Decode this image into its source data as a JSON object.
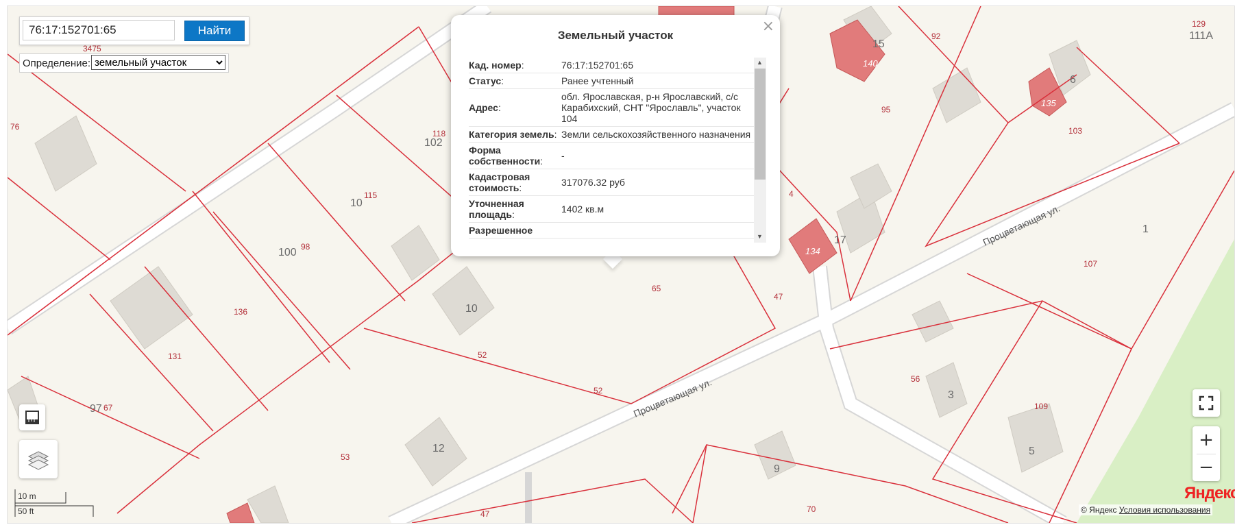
{
  "search": {
    "value": "76:17:152701:65",
    "button_label": "Найти"
  },
  "definition": {
    "label": "Определение:",
    "selected": "земельный участок"
  },
  "popup": {
    "title": "Земельный участок",
    "close": "×",
    "rows": [
      {
        "key": "Кад. номер",
        "value": "76:17:152701:65"
      },
      {
        "key": "Статус",
        "value": "Ранее учтенный"
      },
      {
        "key": "Адрес",
        "value": "обл. Ярославская, р-н Ярославский, с/с Карабихский, СНТ \"Ярославль\", участок 104"
      },
      {
        "key": "Категория земель",
        "value": "Земли сельскохозяйственного назначения"
      },
      {
        "key": "Форма собственности",
        "value": "-"
      },
      {
        "key": "Кадастровая стоимость",
        "value": "317076.32 руб"
      },
      {
        "key": "Уточненная площадь",
        "value": "1402 кв.м"
      },
      {
        "key": "Разрешенное",
        "value": ""
      }
    ]
  },
  "map": {
    "parcel_labels": [
      "3475",
      "76",
      "118",
      "115",
      "98",
      "136",
      "131",
      "67",
      "53",
      "52",
      "52",
      "65",
      "47",
      "47",
      "4",
      "95",
      "92",
      "103",
      "129",
      "107",
      "56",
      "109",
      "70"
    ],
    "house_numbers": [
      "102",
      "10",
      "100",
      "10",
      "97",
      "12",
      "15",
      "6",
      "17",
      "3",
      "5",
      "9",
      "1",
      "111А"
    ],
    "highlighted_houses": [
      "140",
      "135",
      "134"
    ],
    "street_names": [
      "Процветающая ул.",
      "Процветающая ул."
    ],
    "colors": {
      "parcel_line": "#d9303b",
      "building": "#dedbd4",
      "building_highlight": "#e17b7b",
      "road": "#ffffff",
      "background": "#f7f5ee",
      "park": "#d9efc5"
    }
  },
  "controls": {
    "zoom_in": "+",
    "zoom_out": "−"
  },
  "scale": {
    "metric": "10 m",
    "imperial": "50 ft"
  },
  "footer": {
    "logo": "Яндекс",
    "copyright": "© Яндекс",
    "terms": "Условия использования"
  }
}
